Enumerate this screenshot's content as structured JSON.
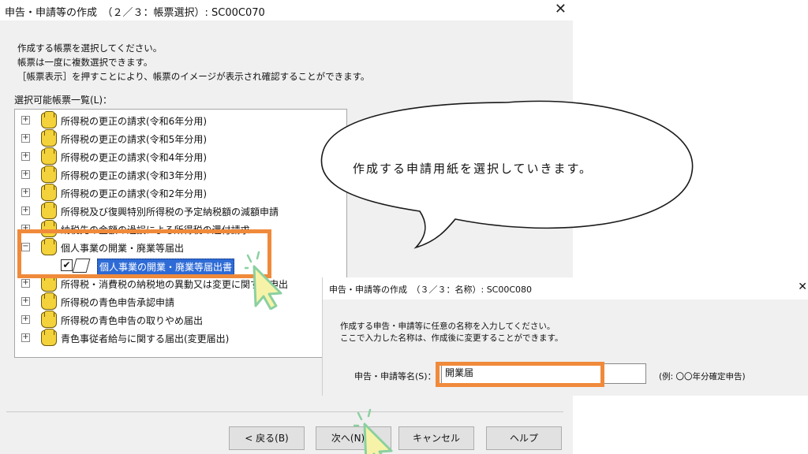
{
  "dialog1": {
    "title": "申告・申請等の作成　（２／３：帳票選択）: SC00C070",
    "instructions": [
      "作成する帳票を選択してください。",
      "帳票は一度に複数選択できます。",
      "［帳票表示］を押すことにより、帳票のイメージが表示され確認することができます。"
    ],
    "list_label": "選択可能帳票一覧(L)：",
    "tree_items": [
      "所得税の更正の請求(令和6年分用)",
      "所得税の更正の請求(令和5年分用)",
      "所得税の更正の請求(令和4年分用)",
      "所得税の更正の請求(令和3年分用)",
      "所得税の更正の請求(令和2年分用)",
      "所得税及び復興特別所得税の予定納税額の減額申請",
      "納税先の金額の過誤による所得税の還付請求",
      "個人事業の開業・廃業等届出",
      "個人事業の開業・廃業等届出書",
      "所得税・消費税の納税地の異動又は変更に関する申出",
      "所得税の青色申告承認申請",
      "所得税の青色申告の取りやめ届出",
      "青色事従者給与に関する届出(変更届出)"
    ],
    "buttons": {
      "back": "< 戻る(B)",
      "next": "次へ(N) >",
      "cancel": "キャンセル",
      "help": "ヘルプ"
    }
  },
  "bubble": {
    "text": "作成する申請用紙を選択していきます。"
  },
  "dialog2": {
    "title": "申告・申請等の作成　（３／３：名称）: SC00C080",
    "instructions": [
      "作成する申告・申請等に任意の名称を入力してください。",
      "ここで入力した名称は、作成後に変更することができます。"
    ],
    "name_label": "申告・申請等名(S)：",
    "name_value": "開業届",
    "hint": "(例: 〇〇年分確定申告)"
  },
  "colors": {
    "highlight": "#f08a3b",
    "selection": "#2e6bd6",
    "cursor_fill": "#f6f3a8",
    "cursor_stroke": "#8bd0a0"
  }
}
